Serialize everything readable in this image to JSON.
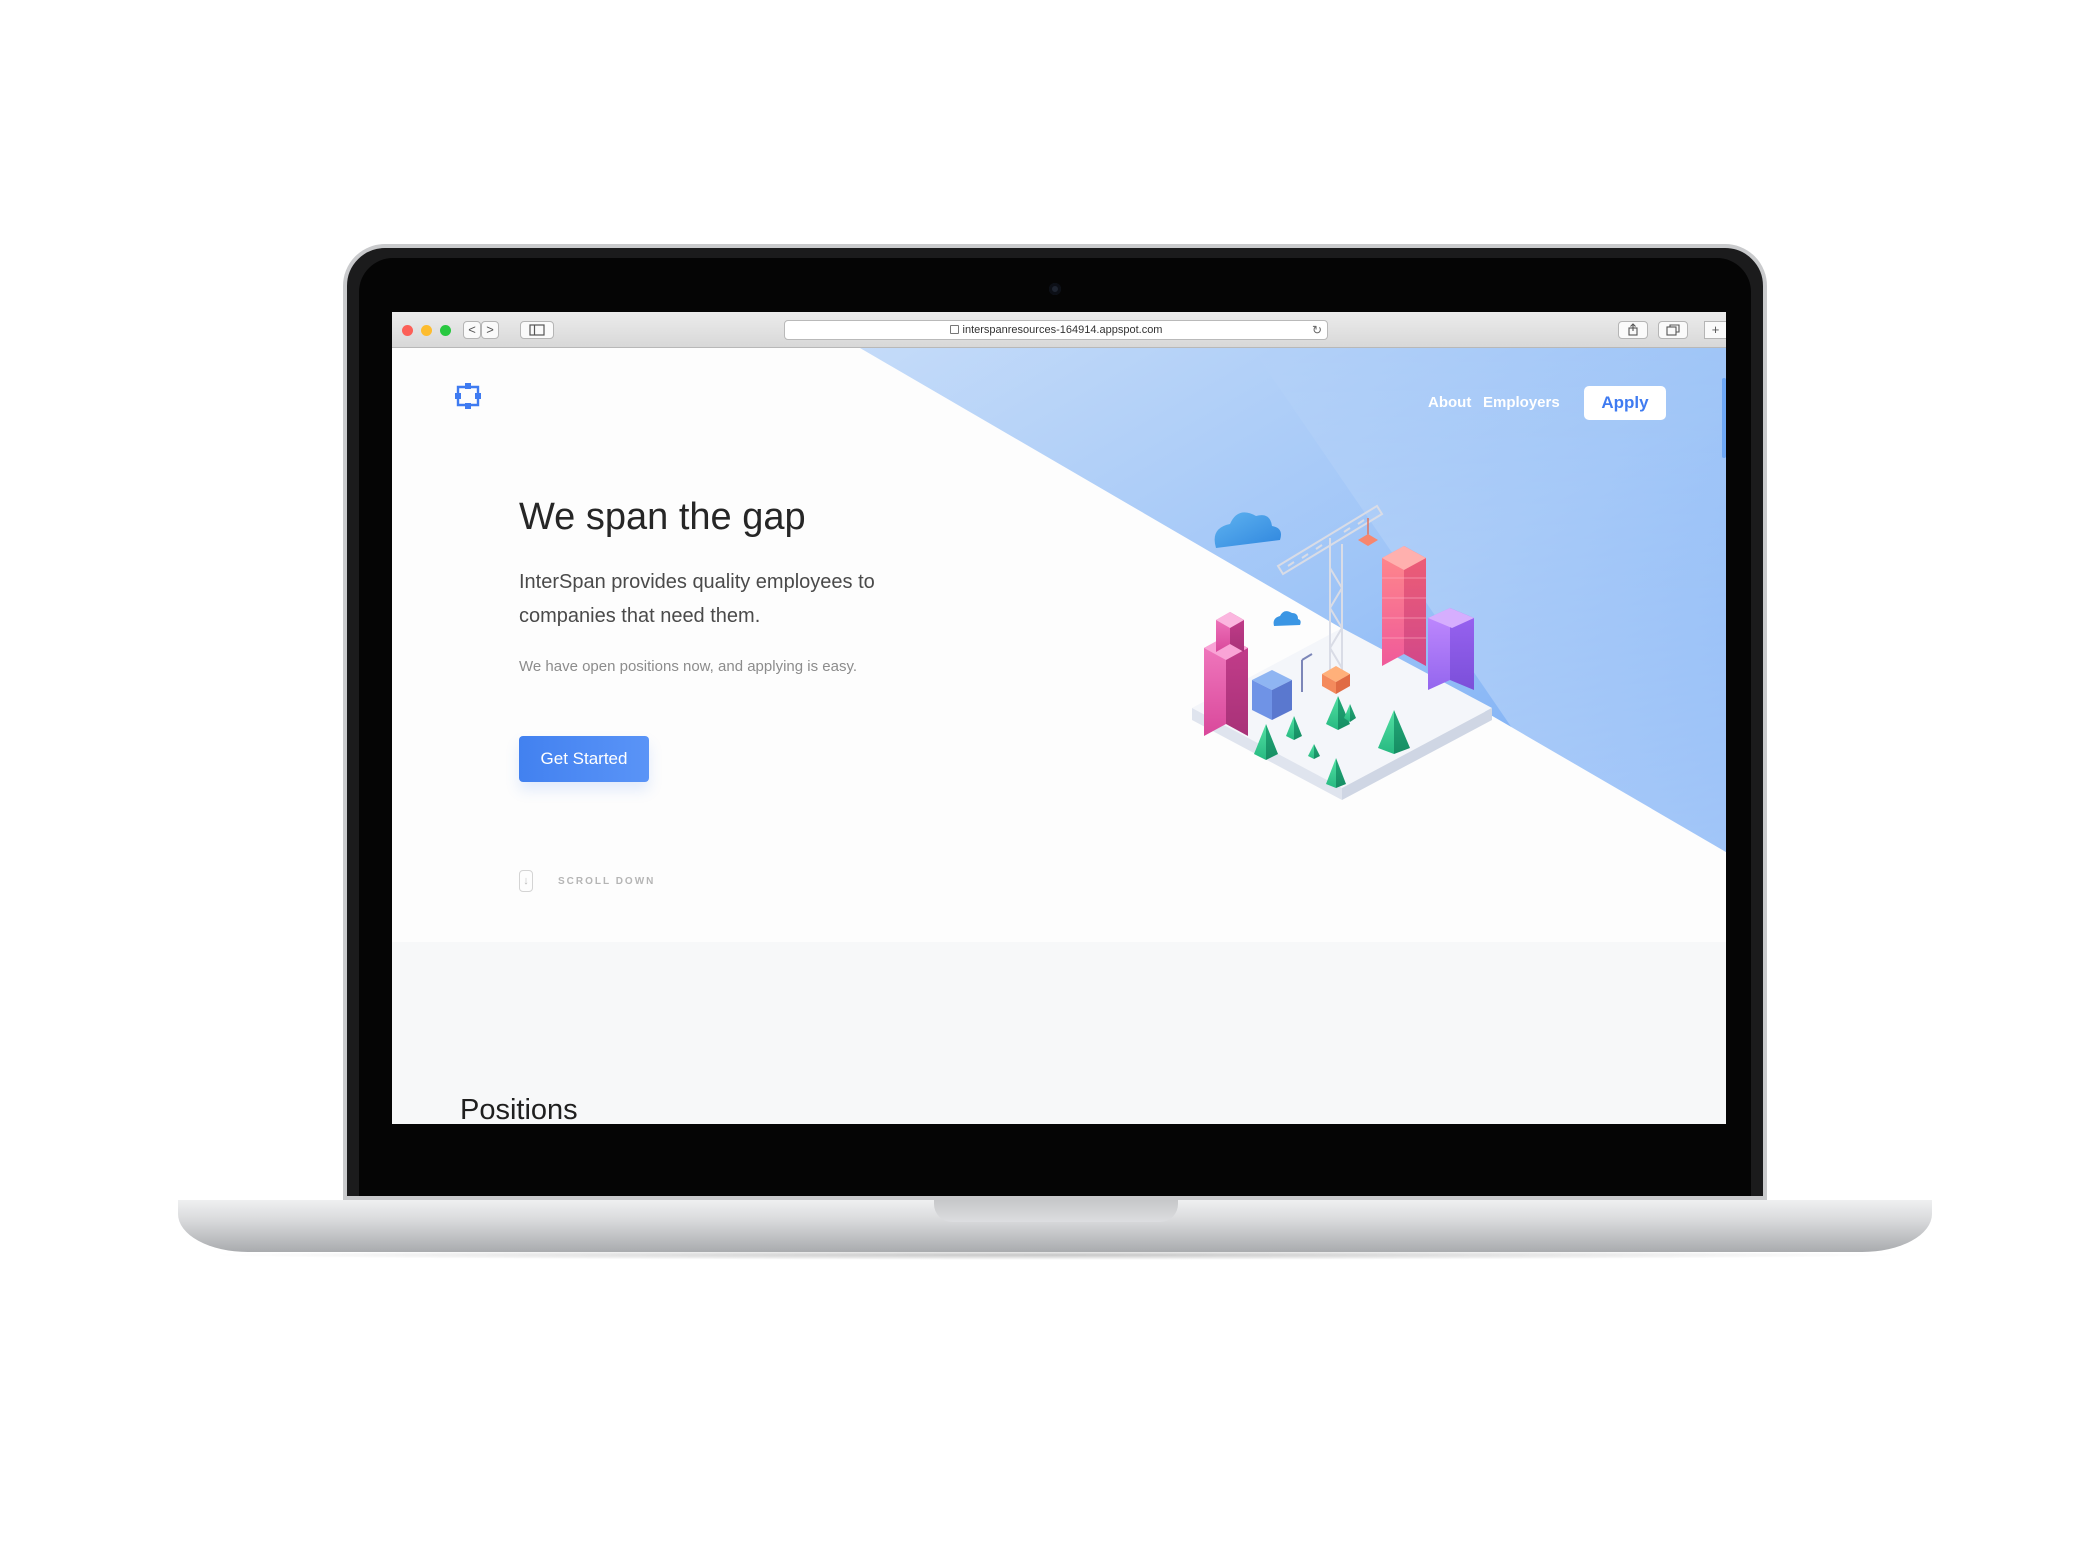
{
  "browser": {
    "url": "interspanresources-164914.appspot.com",
    "back_symbol": "<",
    "forward_symbol": ">",
    "reload_symbol": "↻",
    "new_tab_symbol": "+"
  },
  "nav": {
    "items": [
      {
        "label": "About"
      },
      {
        "label": "Employers"
      }
    ],
    "apply_label": "Apply"
  },
  "hero": {
    "headline": "We span the gap",
    "subheadline": "InterSpan provides quality employees to companies that need them.",
    "note": "We have open positions now, and applying is easy.",
    "cta_label": "Get Started",
    "scroll_label": "SCROLL DOWN",
    "scroll_arrow": "↓"
  },
  "positions": {
    "title": "Positions"
  },
  "colors": {
    "accent": "#3f7bf1",
    "hero_gradient_start": "#b6d3f8",
    "hero_gradient_end": "#6fa8f6",
    "building_pink": "#e85aa6",
    "building_coral": "#f97a8c",
    "building_purple": "#a86ff0",
    "tree_green": "#2dc38b"
  },
  "icons": {
    "logo": "interspan-logo-icon",
    "scroll": "arrow-down-icon",
    "lock": "lock-icon",
    "reload": "reload-icon",
    "sidebar": "sidebar-icon",
    "share": "share-icon",
    "tabs": "tabs-icon"
  }
}
